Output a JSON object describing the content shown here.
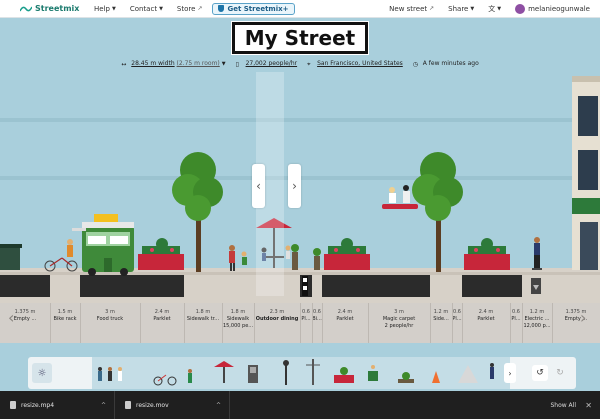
{
  "nav": {
    "logo_text": "Streetmix",
    "help": "Help",
    "contact": "Contact",
    "store": "Store",
    "get_button": "Get Streetmix+",
    "new_street": "New street",
    "share": "Share",
    "username": "melanieogunwale"
  },
  "street": {
    "title": "My Street",
    "width": "28.45 m width",
    "room": "(2.75 m room)",
    "population": "27,002 people/hr",
    "location": "San Francisco, United States",
    "updated": "A few minutes ago"
  },
  "segments": [
    {
      "width": "1.375 m",
      "name": "Empty ..."
    },
    {
      "width": "1.5 m",
      "name": "Bike rack"
    },
    {
      "width": "3 m",
      "name": "Food truck"
    },
    {
      "width": "2.4 m",
      "name": "Parklet"
    },
    {
      "width": "1.8 m",
      "name": "Sidewalk tr..."
    },
    {
      "width": "1.8 m",
      "name": "Sidewalk",
      "extra": "15,000 pe..."
    },
    {
      "width": "2.3 m",
      "name": "Outdoor dining"
    },
    {
      "width": "0.6",
      "name": "Pl..."
    },
    {
      "width": "0.6",
      "name": "Bi..."
    },
    {
      "width": "2.4 m",
      "name": "Parklet"
    },
    {
      "width": "3 m",
      "name": "Magic carpet",
      "extra": "2 people/hr"
    },
    {
      "width": "1.2 m",
      "name": "Side..."
    },
    {
      "width": "0.6",
      "name": "Pl..."
    },
    {
      "width": "2.4 m",
      "name": "Parklet"
    },
    {
      "width": "0.6",
      "name": "Pl..."
    },
    {
      "width": "1.2 m",
      "name": "Electric ...",
      "extra": "12,000 p..."
    },
    {
      "width": "1.375 m",
      "name": "Empty ..."
    }
  ],
  "downloads": {
    "files": [
      "resize.mp4",
      "resize.mov"
    ],
    "show_all": "Show All"
  },
  "colors": {
    "sky": "#a9cfdc",
    "brand": "#1a7a6d",
    "asphalt": "#2b2b2b",
    "sidewalk": "#d7d1c8",
    "parklet_red": "#c7263a",
    "truck_green": "#3f8a3a"
  }
}
